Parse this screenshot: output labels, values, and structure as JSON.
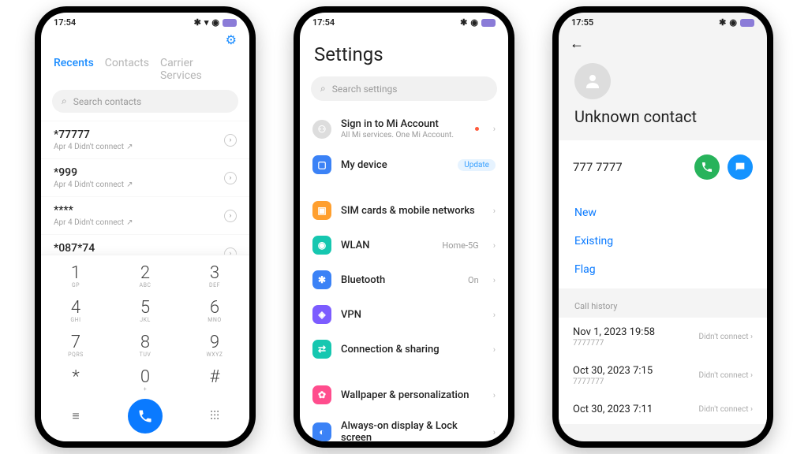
{
  "status": {
    "time1": "17:54",
    "time2": "17:54",
    "time3": "17:55"
  },
  "dialer": {
    "tabs": [
      "Recents",
      "Contacts",
      "Carrier Services"
    ],
    "search_placeholder": "Search contacts",
    "calls": [
      {
        "num": "*77777",
        "sub": "Apr 4 Didn't connect"
      },
      {
        "num": "*999",
        "sub": "Apr 4 Didn't connect"
      },
      {
        "num": "****",
        "sub": "Apr 4 Didn't connect"
      },
      {
        "num": "*087*74",
        "sub": ""
      }
    ],
    "keys": [
      {
        "d": "1",
        "l": "GP"
      },
      {
        "d": "2",
        "l": "ABC"
      },
      {
        "d": "3",
        "l": "DEF"
      },
      {
        "d": "4",
        "l": "GHI"
      },
      {
        "d": "5",
        "l": "JKL"
      },
      {
        "d": "6",
        "l": "MNO"
      },
      {
        "d": "7",
        "l": "PQRS"
      },
      {
        "d": "8",
        "l": "TUV"
      },
      {
        "d": "9",
        "l": "WXYZ"
      },
      {
        "d": "*",
        "l": ""
      },
      {
        "d": "0",
        "l": "+"
      },
      {
        "d": "#",
        "l": ""
      }
    ]
  },
  "settings": {
    "title": "Settings",
    "search_placeholder": "Search settings",
    "account": {
      "label": "Sign in to Mi Account",
      "sub": "All Mi services. One Mi Account."
    },
    "mydevice": {
      "label": "My device",
      "badge": "Update"
    },
    "items": [
      {
        "label": "SIM cards & mobile networks",
        "val": "",
        "color": "#ff9f2e"
      },
      {
        "label": "WLAN",
        "val": "Home-5G",
        "color": "#16c7b0"
      },
      {
        "label": "Bluetooth",
        "val": "On",
        "color": "#3b82f6"
      },
      {
        "label": "VPN",
        "val": "",
        "color": "#7c5cff"
      },
      {
        "label": "Connection & sharing",
        "val": "",
        "color": "#16c7b0"
      }
    ],
    "items2": [
      {
        "label": "Wallpaper & personalization",
        "color": "#ff4d8d"
      },
      {
        "label": "Always-on display & Lock screen",
        "color": "#3b82f6"
      }
    ]
  },
  "contact": {
    "name": "Unknown contact",
    "number": "777 7777",
    "actions": [
      "New",
      "Existing",
      "Flag"
    ],
    "section": "Call history",
    "history": [
      {
        "d": "Nov 1, 2023 19:58",
        "s": "7777777",
        "r": "Didn't connect"
      },
      {
        "d": "Oct 30, 2023 7:15",
        "s": "7777777",
        "r": "Didn't connect"
      },
      {
        "d": "Oct 30, 2023 7:11",
        "s": "",
        "r": "Didn't connect"
      }
    ]
  }
}
